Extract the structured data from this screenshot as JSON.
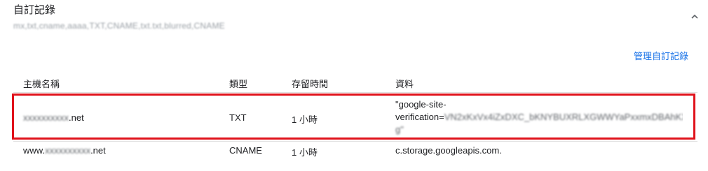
{
  "section": {
    "title": "自訂記錄",
    "summary": "mx,txt,cname,aaaa,TXT,CNAME,txt.txt,blurred,CNAME"
  },
  "actions": {
    "manage_label": "管理自訂記錄"
  },
  "table": {
    "headers": [
      "主機名稱",
      "類型",
      "存留時間",
      "資料"
    ],
    "rows": [
      {
        "host_prefix": "xxxxxxxxxx",
        "host_suffix": ".net",
        "type": "TXT",
        "ttl": "1 小時",
        "data_line1": "\"google-site-",
        "data_line2_prefix": "verification=",
        "data_line2_blur": "VN2xKxVx4iZxDXC_bKNYBUXRLXGWWYaPxxmxDBAhKXKXKQ",
        "data_line3_blur": "g\""
      },
      {
        "host_prefix": "www.",
        "host_blur": "xxxxxxxxxx",
        "host_suffix": ".net",
        "type": "CNAME",
        "ttl": "1 小時",
        "data": "c.storage.googleapis.com."
      }
    ]
  },
  "highlight_color": "#e0121b",
  "accent_color": "#1a73e8"
}
